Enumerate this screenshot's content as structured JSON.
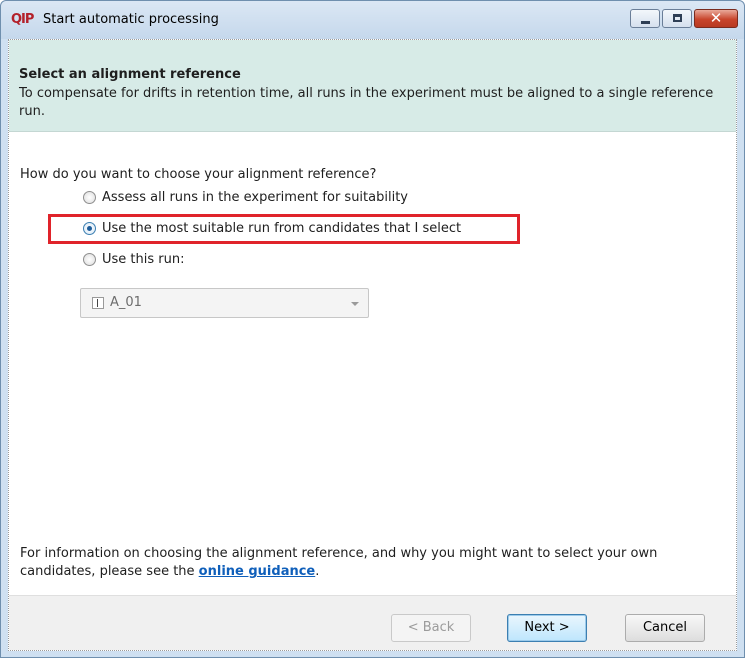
{
  "window": {
    "app_logo": "QIP",
    "title": "Start automatic processing",
    "colors": {
      "title_gradient": "#c5d8ec",
      "close_button": "#c8452c",
      "header_panel": "#d7ebe7",
      "highlight": "#e0232a",
      "link": "#0f5fba"
    }
  },
  "header": {
    "title": "Select an alignment reference",
    "description": "To compensate for drifts in retention time, all runs in the experiment must be aligned to a single reference run."
  },
  "question": "How do you want to choose your alignment reference?",
  "options": [
    {
      "label": "Assess all runs in the experiment for suitability",
      "selected": false
    },
    {
      "label": "Use the most suitable run from candidates that I select",
      "selected": true
    },
    {
      "label": "Use this run:",
      "selected": false
    }
  ],
  "run_select": {
    "value": "A_01",
    "enabled": false,
    "icon": "run-icon"
  },
  "info": {
    "text_before": "For information on choosing the alignment reference, and why you might want to select your own candidates, please see the ",
    "link": "online guidance",
    "text_after": "."
  },
  "buttons": {
    "back": "< Back",
    "next": "Next >",
    "cancel": "Cancel"
  }
}
